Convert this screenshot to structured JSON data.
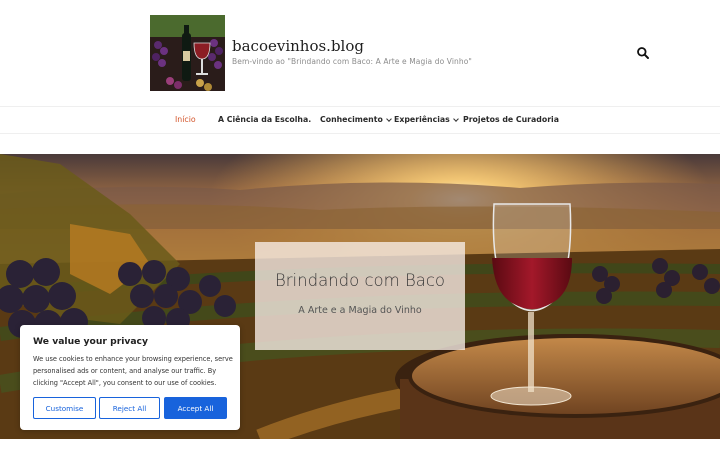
{
  "site": {
    "title": "bacoevinhos.blog",
    "tagline": "Bem-vindo ao \"Brindando com Baco: A Arte e Magia do Vinho\"",
    "logo_icon": "wine-bottle-logo-icon",
    "search_icon": "search-icon"
  },
  "nav": {
    "items": [
      {
        "label": "Início",
        "active": true
      },
      {
        "label": "A Ciência da Escolha.",
        "active": false
      },
      {
        "label": "Conhecimento",
        "active": false,
        "has_dropdown": true
      },
      {
        "label": "Experiências",
        "active": false,
        "has_dropdown": true
      },
      {
        "label": "Projetos de Curadoria",
        "active": false
      }
    ]
  },
  "hero": {
    "title": "Brindando com Baco",
    "subtitle": "A Arte e a Magia do Vinho"
  },
  "cookie_banner": {
    "title": "We value your privacy",
    "text": "We use cookies to enhance your browsing experience, serve personalised ads or content, and analyse our traffic. By clicking \"Accept All\", you consent to our use of cookies.",
    "customise_label": "Customise",
    "reject_label": "Reject All",
    "accept_label": "Accept All"
  },
  "colors": {
    "accent": "#d3542a",
    "cookie_button": "#1863dc"
  }
}
